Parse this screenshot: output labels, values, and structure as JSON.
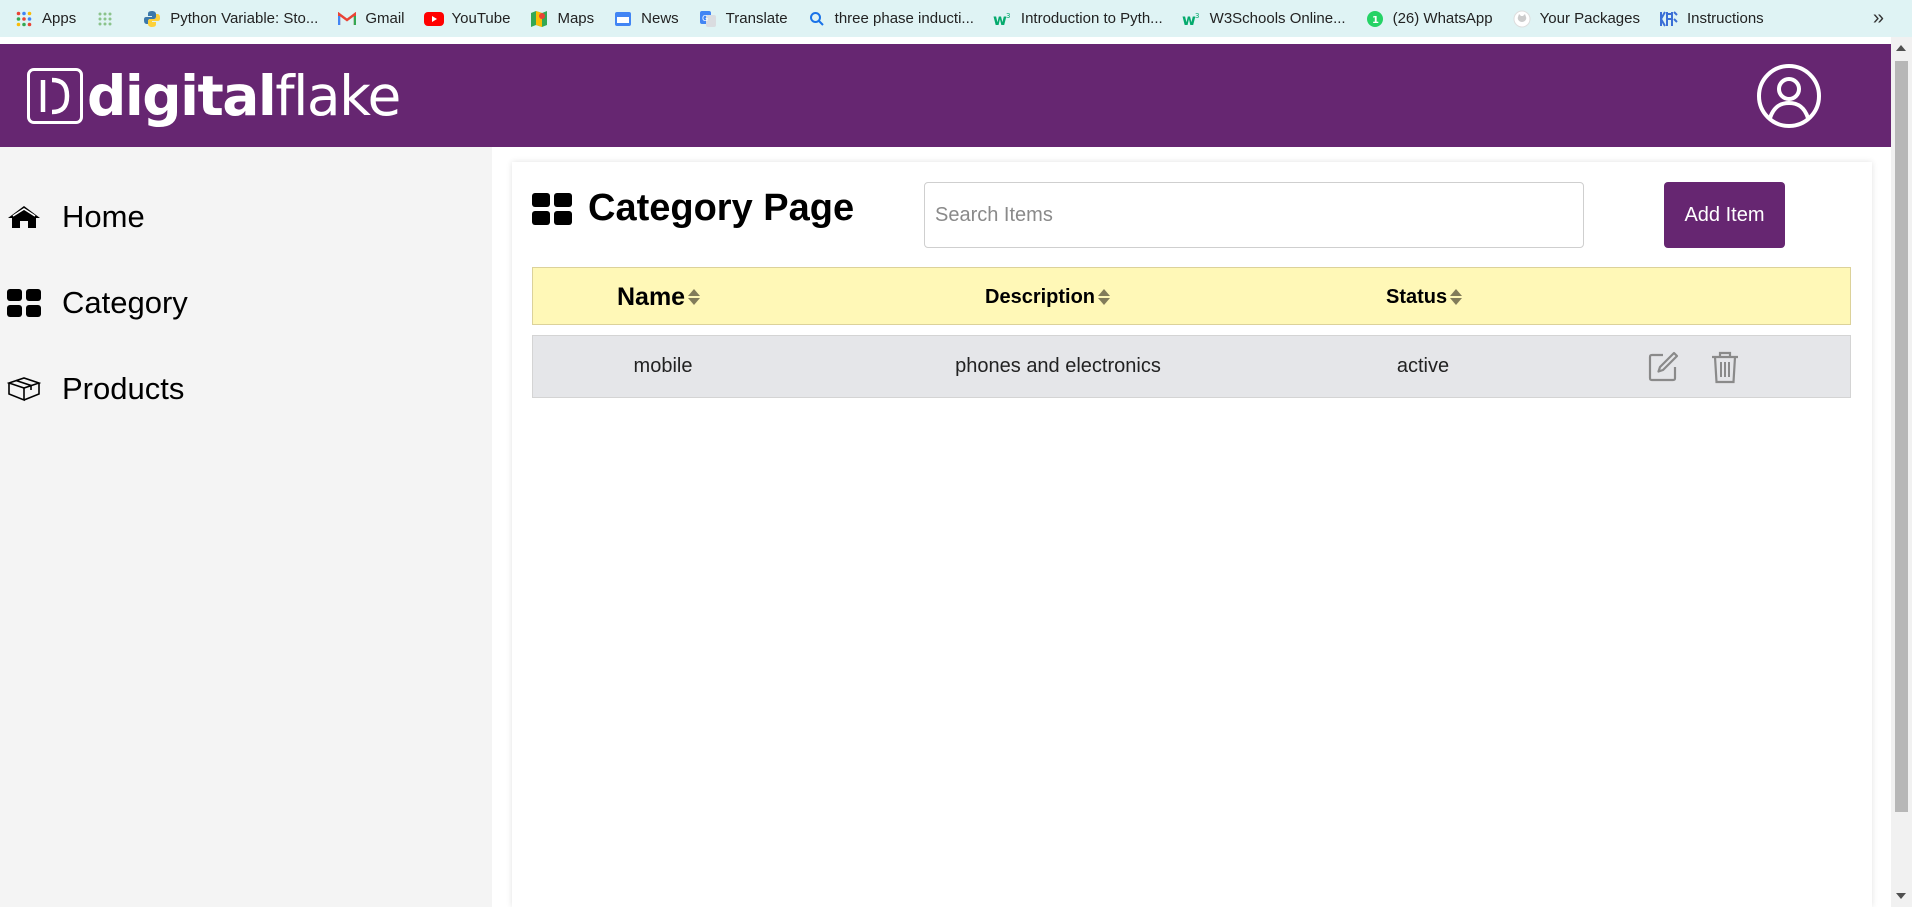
{
  "bookmarks": {
    "items": [
      {
        "label": "Apps",
        "icon": "apps-grid-icon"
      },
      {
        "label": "",
        "icon": "dots-icon"
      },
      {
        "label": "Python Variable: Sto...",
        "icon": "python-icon"
      },
      {
        "label": "Gmail",
        "icon": "gmail-icon"
      },
      {
        "label": "YouTube",
        "icon": "youtube-icon"
      },
      {
        "label": "Maps",
        "icon": "maps-icon"
      },
      {
        "label": "News",
        "icon": "news-icon"
      },
      {
        "label": "Translate",
        "icon": "translate-icon"
      },
      {
        "label": "three phase inducti...",
        "icon": "search-icon"
      },
      {
        "label": "Introduction to Pyth...",
        "icon": "w3schools-icon"
      },
      {
        "label": "W3Schools Online...",
        "icon": "w3schools-icon"
      },
      {
        "label": "(26) WhatsApp",
        "icon": "whatsapp-icon"
      },
      {
        "label": "Your Packages",
        "icon": "github-icon"
      },
      {
        "label": "Instructions",
        "icon": "instructions-icon"
      }
    ],
    "more": "»"
  },
  "header": {
    "logo_bold": "digital",
    "logo_light": "flake",
    "logo_mark": "D",
    "brand_color": "#662671"
  },
  "sidebar": {
    "items": [
      {
        "label": "Home",
        "icon": "home-icon"
      },
      {
        "label": "Category",
        "icon": "grid-icon"
      },
      {
        "label": "Products",
        "icon": "box-icon"
      }
    ]
  },
  "main": {
    "title": "Category Page",
    "search_placeholder": "Search Items",
    "search_value": "",
    "add_button": "Add Item",
    "table": {
      "columns": [
        "Name",
        "Description",
        "Status"
      ],
      "header_color": "#fff8b7",
      "rows": [
        {
          "name": "mobile",
          "description": "phones and electronics",
          "status": "active"
        }
      ]
    }
  }
}
